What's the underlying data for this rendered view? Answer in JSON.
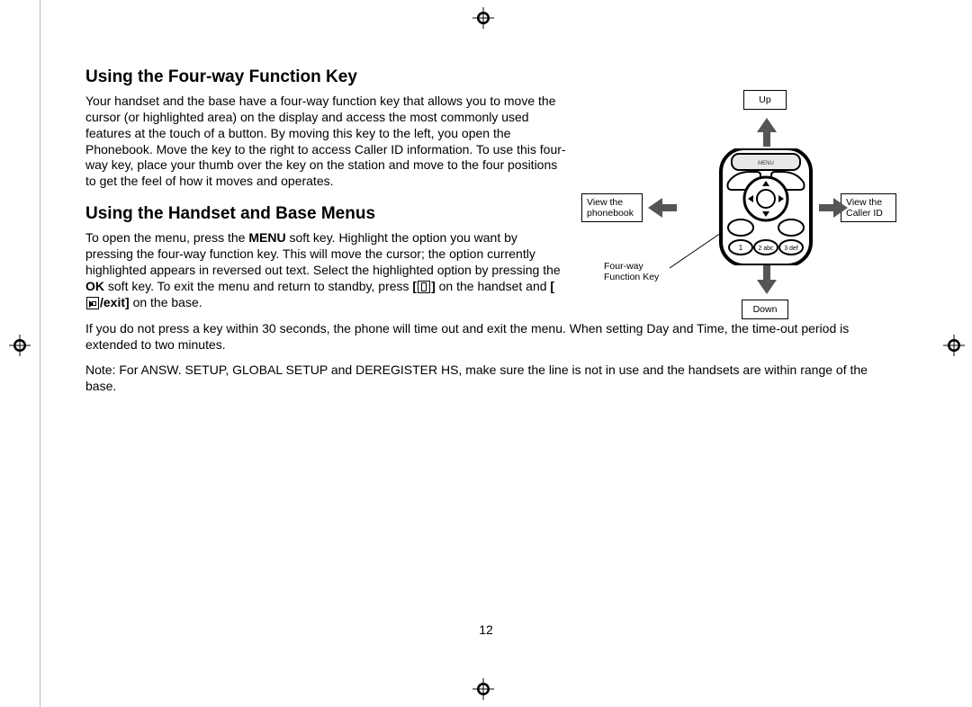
{
  "page_number": "12",
  "section1": {
    "heading": "Using the Four-way Function Key",
    "body": "Your handset and the base have a four-way function key that allows you to move the cursor (or highlighted area) on the display and access the most commonly used features at the touch of a button. By moving this key to the left, you open the Phonebook. Move the key to the right to access Caller ID information. To use this four-way key, place your thumb over the key on the station and move to the four positions to get the feel of how it moves and operates."
  },
  "section2": {
    "heading": "Using the Handset and Base Menus",
    "body_pre": "To open the menu, press the ",
    "menu_key": "MENU",
    "body_mid1": " soft key. Highlight the option you want by pressing the four-way function key. This will move the cursor; the option currently highlighted appears in reversed out text. Select the highlighted option by pressing the ",
    "ok_key": "OK",
    "body_mid2": " soft key. To exit the menu and return to standby, press ",
    "on_handset": " on the handset and ",
    "exit_key": "/exit]",
    "body_tail": " on the base.",
    "timeout": "If you do not press a key within 30 seconds, the phone will time out and exit the menu. When setting Day and Time, the time-out period is extended to two minutes.",
    "note": "Note: For ANSW. SETUP, GLOBAL SETUP and DEREGISTER HS, make sure the line is not in use and the handsets are within range of the base."
  },
  "figure": {
    "up": "Up",
    "down": "Down",
    "left_line1": "View the",
    "left_line2": "phonebook",
    "right_line1": "View the",
    "right_line2": "Caller ID",
    "fk_line1": "Four-way",
    "fk_line2": "Function Key"
  }
}
